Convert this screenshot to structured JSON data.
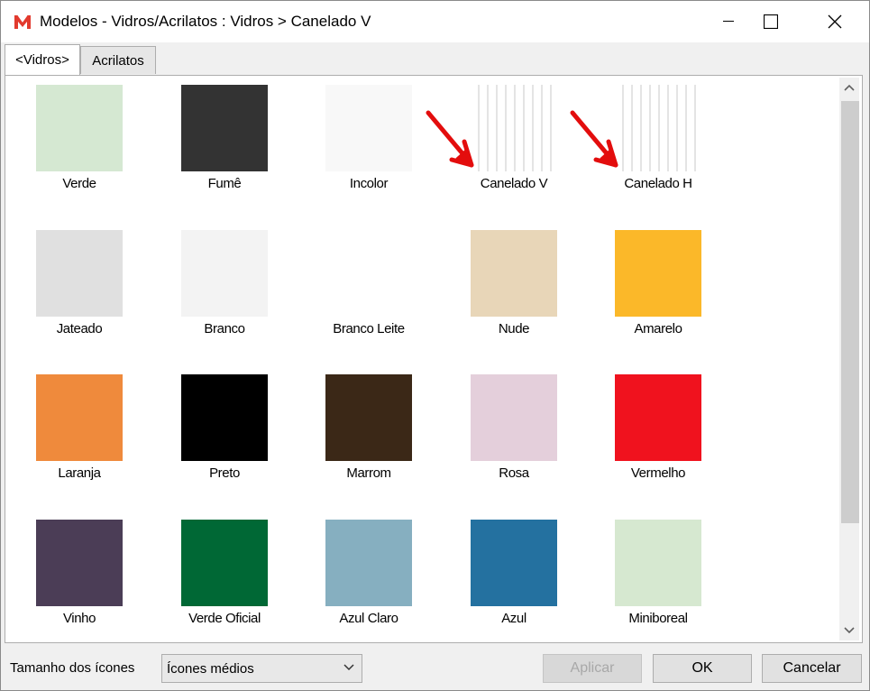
{
  "window": {
    "title": "Modelos - Vidros/Acrilatos :  Vidros > Canelado V",
    "app_icon": "app-logo-icon",
    "controls": [
      "minimize-icon",
      "maximize-icon",
      "close-icon"
    ]
  },
  "tabs": [
    {
      "label": "<Vidros>",
      "active": true
    },
    {
      "label": "Acrilatos",
      "active": false
    }
  ],
  "items": [
    {
      "label": "Verde",
      "color": "#d5e8d2"
    },
    {
      "label": "Fumê",
      "color": "#333333"
    },
    {
      "label": "Incolor",
      "color": "#f8f8f8"
    },
    {
      "label": "Canelado V",
      "color": "#f5f5f5",
      "pattern": "striped"
    },
    {
      "label": "Canelado H",
      "color": "#f5f5f5",
      "pattern": "striped"
    },
    {
      "label": "Jateado",
      "color": "#e0e0e0"
    },
    {
      "label": "Branco",
      "color": "#f3f3f3"
    },
    {
      "label": "Branco Leite",
      "color": "#ffffff"
    },
    {
      "label": "Nude",
      "color": "#e8d6b8"
    },
    {
      "label": "Amarelo",
      "color": "#fbb829"
    },
    {
      "label": "Laranja",
      "color": "#ef8a3c"
    },
    {
      "label": "Preto",
      "color": "#000000"
    },
    {
      "label": "Marrom",
      "color": "#3b2817"
    },
    {
      "label": "Rosa",
      "color": "#e4cfdb"
    },
    {
      "label": "Vermelho",
      "color": "#f0121e"
    },
    {
      "label": "Vinho",
      "color": "#4b3d56"
    },
    {
      "label": "Verde Oficial",
      "color": "#006835"
    },
    {
      "label": "Azul Claro",
      "color": "#86afc0"
    },
    {
      "label": "Azul",
      "color": "#2471a0"
    },
    {
      "label": "Miniboreal",
      "color": "#d6e8d0"
    }
  ],
  "bottom": {
    "size_label": "Tamanho dos ícones",
    "size_value": "Ícones médios",
    "apply_label": "Aplicar",
    "ok_label": "OK",
    "cancel_label": "Cancelar"
  },
  "annotation_color": "#e30d0d"
}
